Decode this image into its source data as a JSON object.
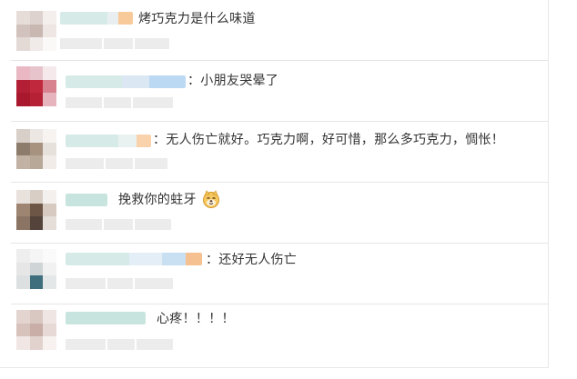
{
  "comments": [
    {
      "text": "烤巧克力是什么味道"
    },
    {
      "text": "：小朋友哭晕了"
    },
    {
      "text": "：无人伤亡就好。巧克力啊，好可惜，那么多巧克力，惆怅！"
    },
    {
      "text": "挽救你的蛀牙",
      "emoji": "smiling-doge-face-icon"
    },
    {
      "text": "：还好无人伤亡"
    },
    {
      "text": "心疼！！！！"
    }
  ],
  "colors": {
    "text": "#333333",
    "divider": "#e5e5e5",
    "blur_teal": "#cfe6e3",
    "blur_blue": "#c5def5",
    "blur_orange": "#f7c79a",
    "blur_gray": "#ececec"
  }
}
